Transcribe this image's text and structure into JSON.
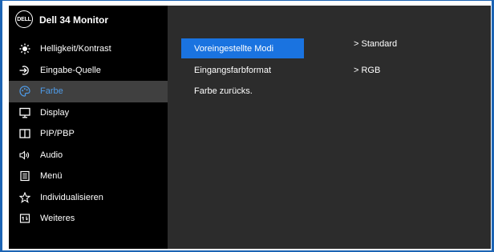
{
  "brand": {
    "logo_text": "DELL",
    "title": "Dell  34 Monitor"
  },
  "menu": [
    {
      "label": "Helligkeit/Kontrast",
      "icon": "brightness-icon"
    },
    {
      "label": "Eingabe-Quelle",
      "icon": "input-source-icon"
    },
    {
      "label": "Farbe",
      "icon": "color-palette-icon",
      "active": true
    },
    {
      "label": "Display",
      "icon": "display-icon"
    },
    {
      "label": "PIP/PBP",
      "icon": "pip-pbp-icon"
    },
    {
      "label": "Audio",
      "icon": "speaker-icon"
    },
    {
      "label": "Menü",
      "icon": "menu-list-icon"
    },
    {
      "label": "Individualisieren",
      "icon": "star-icon"
    },
    {
      "label": "Weiteres",
      "icon": "others-icon"
    }
  ],
  "submenu": {
    "items": [
      {
        "label": "Voreingestellte Modi",
        "value": "> Standard",
        "selected": true
      },
      {
        "label": "Eingangsfarbformat",
        "value": "> RGB"
      },
      {
        "label": "Farbe zurücks.",
        "value": ""
      }
    ]
  },
  "colors": {
    "frame_border": "#1c64b4",
    "sidebar_bg": "#000000",
    "content_bg": "#2c2c2c",
    "active_row_bg": "#404040",
    "active_label": "#4e9be8",
    "selected_item_bg": "#1a73e0"
  }
}
